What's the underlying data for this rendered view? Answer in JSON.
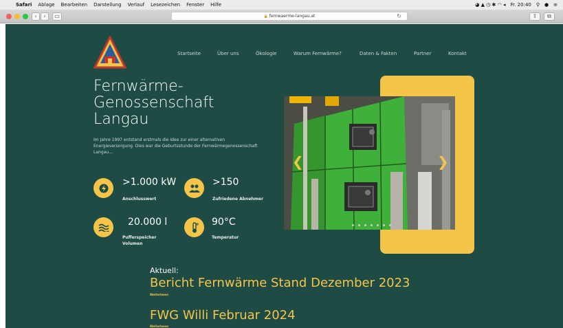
{
  "menubar": {
    "apple": "",
    "app": "Safari",
    "items": [
      "Ablage",
      "Bearbeiten",
      "Darstellung",
      "Verlauf",
      "Lesezeichen",
      "Fenster",
      "Hilfe"
    ],
    "clock": "Fr. 20:40"
  },
  "browser": {
    "url": "fernwaerme-langau.at",
    "lock": "🔒"
  },
  "nav": [
    "Startseite",
    "Über uns",
    "Ökologie",
    "Warum Fernwärme?",
    "Daten & Fakten",
    "Partner",
    "Kontakt"
  ],
  "hero": {
    "title": "Fernwärme-\nGenossenschaft\nLangau",
    "intro": "Im Jahre 1997 entstand erstmals die Idee zur einer alternativen Energieversorgung. Dies war die Geburtsstunde der Fernwärmegenossenschaft Langau..."
  },
  "stats": [
    {
      "icon": "lightning-icon",
      "value": ">1.000 kW",
      "label": "Anschlusswert"
    },
    {
      "icon": "people-icon",
      "value": ">150",
      "label": "Zufriedene Abnehmer"
    },
    {
      "icon": "water-icon",
      "value": "20.000 l",
      "label": "Pufferspeicher\nVolumen"
    },
    {
      "icon": "thermometer-icon",
      "value": "90°C",
      "label": "Temperatur"
    }
  ],
  "carousel": {
    "prev": "❮",
    "next": "❯",
    "slides": 7
  },
  "news": {
    "heading": "Aktuell:",
    "items": [
      {
        "title": "Bericht Fernwärme Stand Dezember 2023",
        "link": "Weiterlesen"
      },
      {
        "title": "FWG Willi Februar 2024",
        "link": "Weiterlesen"
      }
    ]
  },
  "colors": {
    "background": "#1f4b45",
    "accent": "#f5c54a"
  }
}
